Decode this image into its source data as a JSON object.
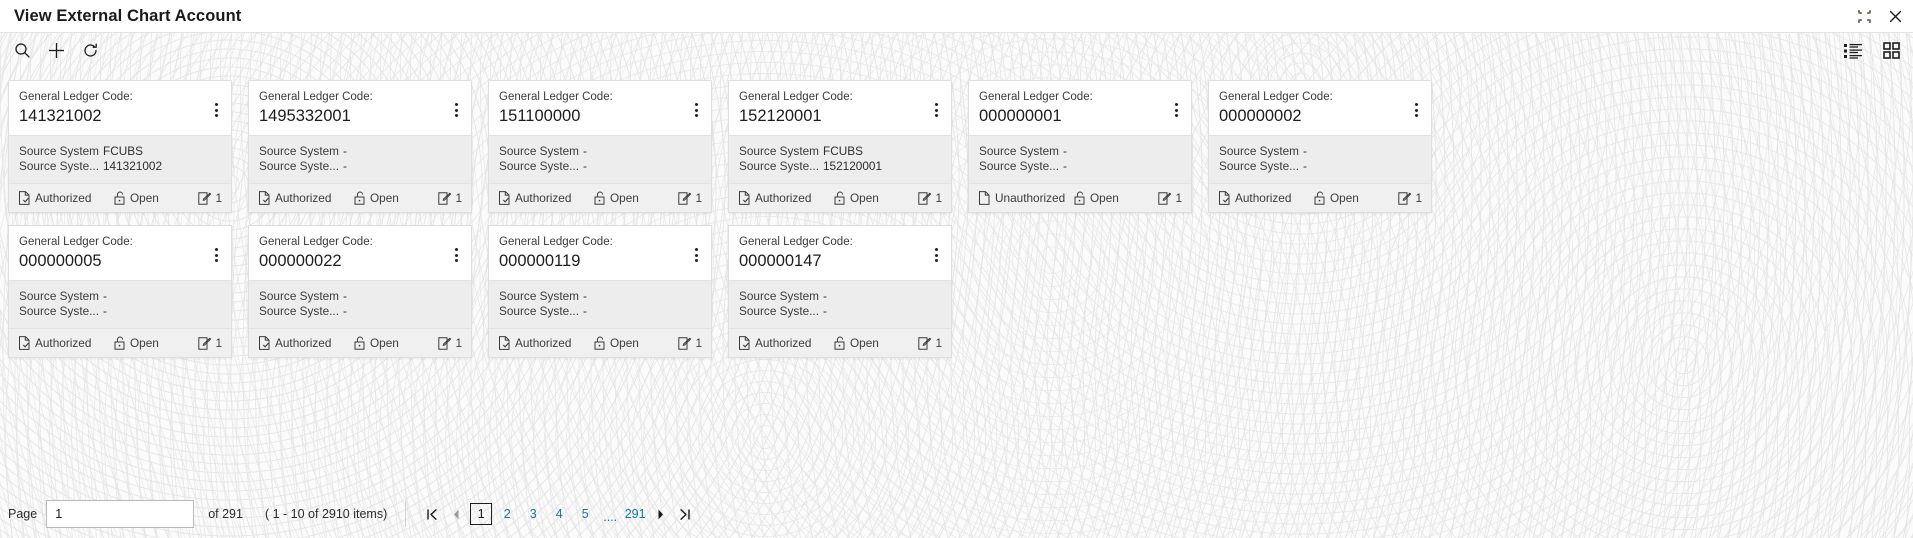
{
  "header": {
    "title": "View External Chart Account",
    "actions": [
      {
        "name": "minimize-icon",
        "label": "Minimize"
      },
      {
        "name": "close-icon",
        "label": "Close"
      }
    ]
  },
  "toolbar": {
    "left": [
      {
        "name": "search-icon",
        "label": "Search"
      },
      {
        "name": "add-icon",
        "label": "Add"
      },
      {
        "name": "refresh-icon",
        "label": "Refresh"
      }
    ],
    "right": [
      {
        "name": "list-view-icon",
        "label": "List View"
      },
      {
        "name": "grid-view-icon",
        "label": "Grid View"
      }
    ]
  },
  "card_labels": {
    "code_label": "General Ledger Code:",
    "source_system_key": "Source System",
    "source_system_number_key": "Source Syste...",
    "kebab_label": "More options"
  },
  "cards": [
    {
      "code": "141321002",
      "source_system": "FCUBS",
      "source_system_number": "141321002",
      "auth_status": "Authorized",
      "auth_icon": "document-check-icon",
      "record_status": "Open",
      "record_icon": "unlock-icon",
      "mod_no": "1",
      "mod_icon": "edit-square-icon"
    },
    {
      "code": "1495332001",
      "source_system": "-",
      "source_system_number": "-",
      "auth_status": "Authorized",
      "auth_icon": "document-check-icon",
      "record_status": "Open",
      "record_icon": "unlock-icon",
      "mod_no": "1",
      "mod_icon": "edit-square-icon"
    },
    {
      "code": "151100000",
      "source_system": "-",
      "source_system_number": "-",
      "auth_status": "Authorized",
      "auth_icon": "document-check-icon",
      "record_status": "Open",
      "record_icon": "unlock-icon",
      "mod_no": "1",
      "mod_icon": "edit-square-icon"
    },
    {
      "code": "152120001",
      "source_system": "FCUBS",
      "source_system_number": "152120001",
      "auth_status": "Authorized",
      "auth_icon": "document-check-icon",
      "record_status": "Open",
      "record_icon": "unlock-icon",
      "mod_no": "1",
      "mod_icon": "edit-square-icon"
    },
    {
      "code": "000000001",
      "source_system": "-",
      "source_system_number": "-",
      "auth_status": "Unauthorized",
      "auth_icon": "document-icon",
      "record_status": "Open",
      "record_icon": "unlock-icon",
      "mod_no": "1",
      "mod_icon": "edit-square-icon"
    },
    {
      "code": "000000002",
      "source_system": "-",
      "source_system_number": "-",
      "auth_status": "Authorized",
      "auth_icon": "document-check-icon",
      "record_status": "Open",
      "record_icon": "unlock-icon",
      "mod_no": "1",
      "mod_icon": "edit-square-icon"
    },
    {
      "code": "000000005",
      "source_system": "-",
      "source_system_number": "-",
      "auth_status": "Authorized",
      "auth_icon": "document-check-icon",
      "record_status": "Open",
      "record_icon": "unlock-icon",
      "mod_no": "1",
      "mod_icon": "edit-square-icon"
    },
    {
      "code": "000000022",
      "source_system": "-",
      "source_system_number": "-",
      "auth_status": "Authorized",
      "auth_icon": "document-check-icon",
      "record_status": "Open",
      "record_icon": "unlock-icon",
      "mod_no": "1",
      "mod_icon": "edit-square-icon"
    },
    {
      "code": "000000119",
      "source_system": "-",
      "source_system_number": "-",
      "auth_status": "Authorized",
      "auth_icon": "document-check-icon",
      "record_status": "Open",
      "record_icon": "unlock-icon",
      "mod_no": "1",
      "mod_icon": "edit-square-icon"
    },
    {
      "code": "000000147",
      "source_system": "-",
      "source_system_number": "-",
      "auth_status": "Authorized",
      "auth_icon": "document-check-icon",
      "record_status": "Open",
      "record_icon": "unlock-icon",
      "mod_no": "1",
      "mod_icon": "edit-square-icon"
    }
  ],
  "pagination": {
    "page_label": "Page",
    "page_value": "1",
    "of_text": "of 291",
    "items_text": "( 1 - 10 of 2910 items)",
    "pages": [
      "1",
      "2",
      "3",
      "4",
      "5"
    ],
    "ellipsis": "....",
    "last_page": "291",
    "current_page": "1",
    "first_icon": "first-page-icon",
    "prev_icon": "prev-page-icon",
    "next_icon": "next-page-icon",
    "last_icon": "last-page-icon"
  },
  "colors": {
    "link": "#1273a8",
    "card_body_bg": "#ededed",
    "card_foot_bg": "#f0f0f0"
  }
}
